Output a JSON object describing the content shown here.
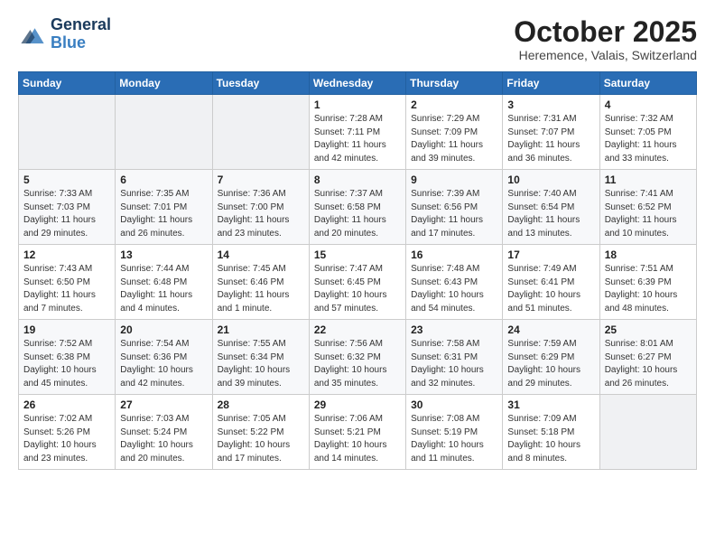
{
  "header": {
    "logo_line1": "General",
    "logo_line2": "Blue",
    "month": "October 2025",
    "location": "Heremence, Valais, Switzerland"
  },
  "weekdays": [
    "Sunday",
    "Monday",
    "Tuesday",
    "Wednesday",
    "Thursday",
    "Friday",
    "Saturday"
  ],
  "weeks": [
    [
      {
        "day": "",
        "info": ""
      },
      {
        "day": "",
        "info": ""
      },
      {
        "day": "",
        "info": ""
      },
      {
        "day": "1",
        "info": "Sunrise: 7:28 AM\nSunset: 7:11 PM\nDaylight: 11 hours\nand 42 minutes."
      },
      {
        "day": "2",
        "info": "Sunrise: 7:29 AM\nSunset: 7:09 PM\nDaylight: 11 hours\nand 39 minutes."
      },
      {
        "day": "3",
        "info": "Sunrise: 7:31 AM\nSunset: 7:07 PM\nDaylight: 11 hours\nand 36 minutes."
      },
      {
        "day": "4",
        "info": "Sunrise: 7:32 AM\nSunset: 7:05 PM\nDaylight: 11 hours\nand 33 minutes."
      }
    ],
    [
      {
        "day": "5",
        "info": "Sunrise: 7:33 AM\nSunset: 7:03 PM\nDaylight: 11 hours\nand 29 minutes."
      },
      {
        "day": "6",
        "info": "Sunrise: 7:35 AM\nSunset: 7:01 PM\nDaylight: 11 hours\nand 26 minutes."
      },
      {
        "day": "7",
        "info": "Sunrise: 7:36 AM\nSunset: 7:00 PM\nDaylight: 11 hours\nand 23 minutes."
      },
      {
        "day": "8",
        "info": "Sunrise: 7:37 AM\nSunset: 6:58 PM\nDaylight: 11 hours\nand 20 minutes."
      },
      {
        "day": "9",
        "info": "Sunrise: 7:39 AM\nSunset: 6:56 PM\nDaylight: 11 hours\nand 17 minutes."
      },
      {
        "day": "10",
        "info": "Sunrise: 7:40 AM\nSunset: 6:54 PM\nDaylight: 11 hours\nand 13 minutes."
      },
      {
        "day": "11",
        "info": "Sunrise: 7:41 AM\nSunset: 6:52 PM\nDaylight: 11 hours\nand 10 minutes."
      }
    ],
    [
      {
        "day": "12",
        "info": "Sunrise: 7:43 AM\nSunset: 6:50 PM\nDaylight: 11 hours\nand 7 minutes."
      },
      {
        "day": "13",
        "info": "Sunrise: 7:44 AM\nSunset: 6:48 PM\nDaylight: 11 hours\nand 4 minutes."
      },
      {
        "day": "14",
        "info": "Sunrise: 7:45 AM\nSunset: 6:46 PM\nDaylight: 11 hours\nand 1 minute."
      },
      {
        "day": "15",
        "info": "Sunrise: 7:47 AM\nSunset: 6:45 PM\nDaylight: 10 hours\nand 57 minutes."
      },
      {
        "day": "16",
        "info": "Sunrise: 7:48 AM\nSunset: 6:43 PM\nDaylight: 10 hours\nand 54 minutes."
      },
      {
        "day": "17",
        "info": "Sunrise: 7:49 AM\nSunset: 6:41 PM\nDaylight: 10 hours\nand 51 minutes."
      },
      {
        "day": "18",
        "info": "Sunrise: 7:51 AM\nSunset: 6:39 PM\nDaylight: 10 hours\nand 48 minutes."
      }
    ],
    [
      {
        "day": "19",
        "info": "Sunrise: 7:52 AM\nSunset: 6:38 PM\nDaylight: 10 hours\nand 45 minutes."
      },
      {
        "day": "20",
        "info": "Sunrise: 7:54 AM\nSunset: 6:36 PM\nDaylight: 10 hours\nand 42 minutes."
      },
      {
        "day": "21",
        "info": "Sunrise: 7:55 AM\nSunset: 6:34 PM\nDaylight: 10 hours\nand 39 minutes."
      },
      {
        "day": "22",
        "info": "Sunrise: 7:56 AM\nSunset: 6:32 PM\nDaylight: 10 hours\nand 35 minutes."
      },
      {
        "day": "23",
        "info": "Sunrise: 7:58 AM\nSunset: 6:31 PM\nDaylight: 10 hours\nand 32 minutes."
      },
      {
        "day": "24",
        "info": "Sunrise: 7:59 AM\nSunset: 6:29 PM\nDaylight: 10 hours\nand 29 minutes."
      },
      {
        "day": "25",
        "info": "Sunrise: 8:01 AM\nSunset: 6:27 PM\nDaylight: 10 hours\nand 26 minutes."
      }
    ],
    [
      {
        "day": "26",
        "info": "Sunrise: 7:02 AM\nSunset: 5:26 PM\nDaylight: 10 hours\nand 23 minutes."
      },
      {
        "day": "27",
        "info": "Sunrise: 7:03 AM\nSunset: 5:24 PM\nDaylight: 10 hours\nand 20 minutes."
      },
      {
        "day": "28",
        "info": "Sunrise: 7:05 AM\nSunset: 5:22 PM\nDaylight: 10 hours\nand 17 minutes."
      },
      {
        "day": "29",
        "info": "Sunrise: 7:06 AM\nSunset: 5:21 PM\nDaylight: 10 hours\nand 14 minutes."
      },
      {
        "day": "30",
        "info": "Sunrise: 7:08 AM\nSunset: 5:19 PM\nDaylight: 10 hours\nand 11 minutes."
      },
      {
        "day": "31",
        "info": "Sunrise: 7:09 AM\nSunset: 5:18 PM\nDaylight: 10 hours\nand 8 minutes."
      },
      {
        "day": "",
        "info": ""
      }
    ]
  ]
}
